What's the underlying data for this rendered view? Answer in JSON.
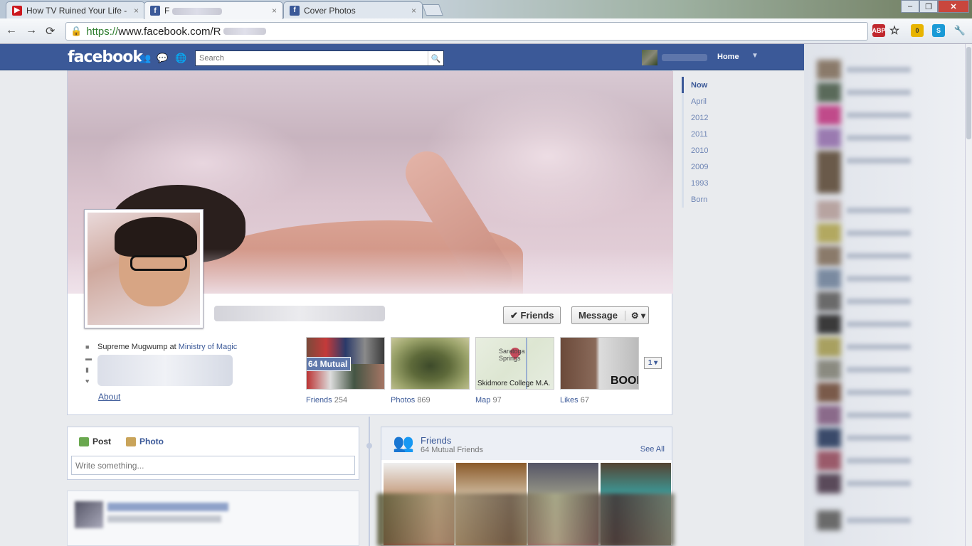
{
  "browser": {
    "tabs": [
      {
        "title": "How TV Ruined Your Life - ",
        "favicon": "youtube-icon",
        "active": false
      },
      {
        "title": "F",
        "favicon": "facebook-icon",
        "active": true
      },
      {
        "title": "Cover Photos",
        "favicon": "facebook-icon",
        "active": false
      }
    ],
    "close_glyph": "×",
    "url_scheme": "https://",
    "url_rest": "www.facebook.com/R",
    "window_buttons": {
      "minimize": "‒",
      "maximize": "❐",
      "close": "✕"
    },
    "extensions": [
      {
        "name": "adblock-icon",
        "label": "ABP",
        "color": "#c0272d"
      },
      {
        "name": "star-icon",
        "label": "☆",
        "color": "#ffffff"
      },
      {
        "name": "extension-icon",
        "label": "0",
        "color": "#333333"
      },
      {
        "name": "skype-icon",
        "label": "S",
        "color": "#1a9ad6"
      },
      {
        "name": "wrench-icon",
        "label": "🔧",
        "color": "#ffffff"
      }
    ]
  },
  "fb": {
    "logo": "facebook",
    "search_placeholder": "Search",
    "home": "Home",
    "colors": {
      "brand": "#3b5998",
      "link": "#3b5998"
    }
  },
  "profile": {
    "actions": {
      "friends": "✔ Friends",
      "message": "Message",
      "gear": "⚙ ▾"
    },
    "info": {
      "job_prefix": "Supreme Mugwump at ",
      "job_link": "Ministry of Magic"
    },
    "about": "About",
    "apps": [
      {
        "label": "Friends",
        "count": "254"
      },
      {
        "label": "Photos",
        "count": "869"
      },
      {
        "label": "Map",
        "count": "97"
      },
      {
        "label": "Likes",
        "count": "67"
      }
    ],
    "mutual_badge": "64 Mutual",
    "map_city": "Saratoga Springs",
    "map_caption": "Skidmore College M.A.",
    "likes_caption": "BOOK",
    "pager": "1 ▾"
  },
  "scrubber": [
    "Now",
    "April",
    "2012",
    "2011",
    "2010",
    "2009",
    "1993",
    "Born"
  ],
  "composer": {
    "post": "Post",
    "photo": "Photo",
    "placeholder": "Write something..."
  },
  "friends_box": {
    "title": "Friends",
    "subtitle": "64 Mutual Friends",
    "see_all": "See All"
  }
}
